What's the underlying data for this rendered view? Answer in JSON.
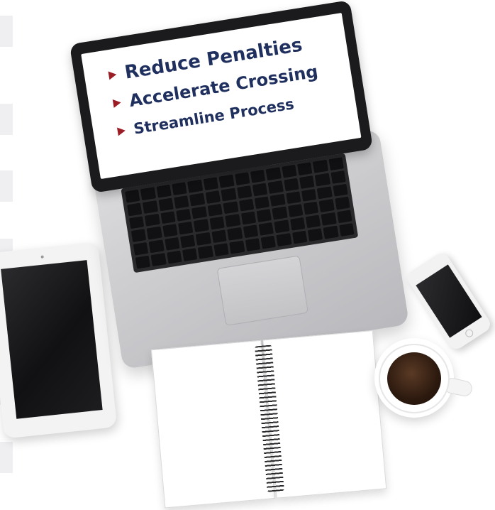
{
  "laptop": {
    "bullets": [
      {
        "text": "Reduce Penalties"
      },
      {
        "text": "Accelerate Crossing"
      },
      {
        "text": "Streamline Process"
      }
    ]
  },
  "colors": {
    "bullet_arrow": "#9b1d26",
    "headline_text": "#1f2f5e",
    "background": "#ffffff"
  },
  "icons": {
    "bullet": "right-triangle-icon"
  }
}
